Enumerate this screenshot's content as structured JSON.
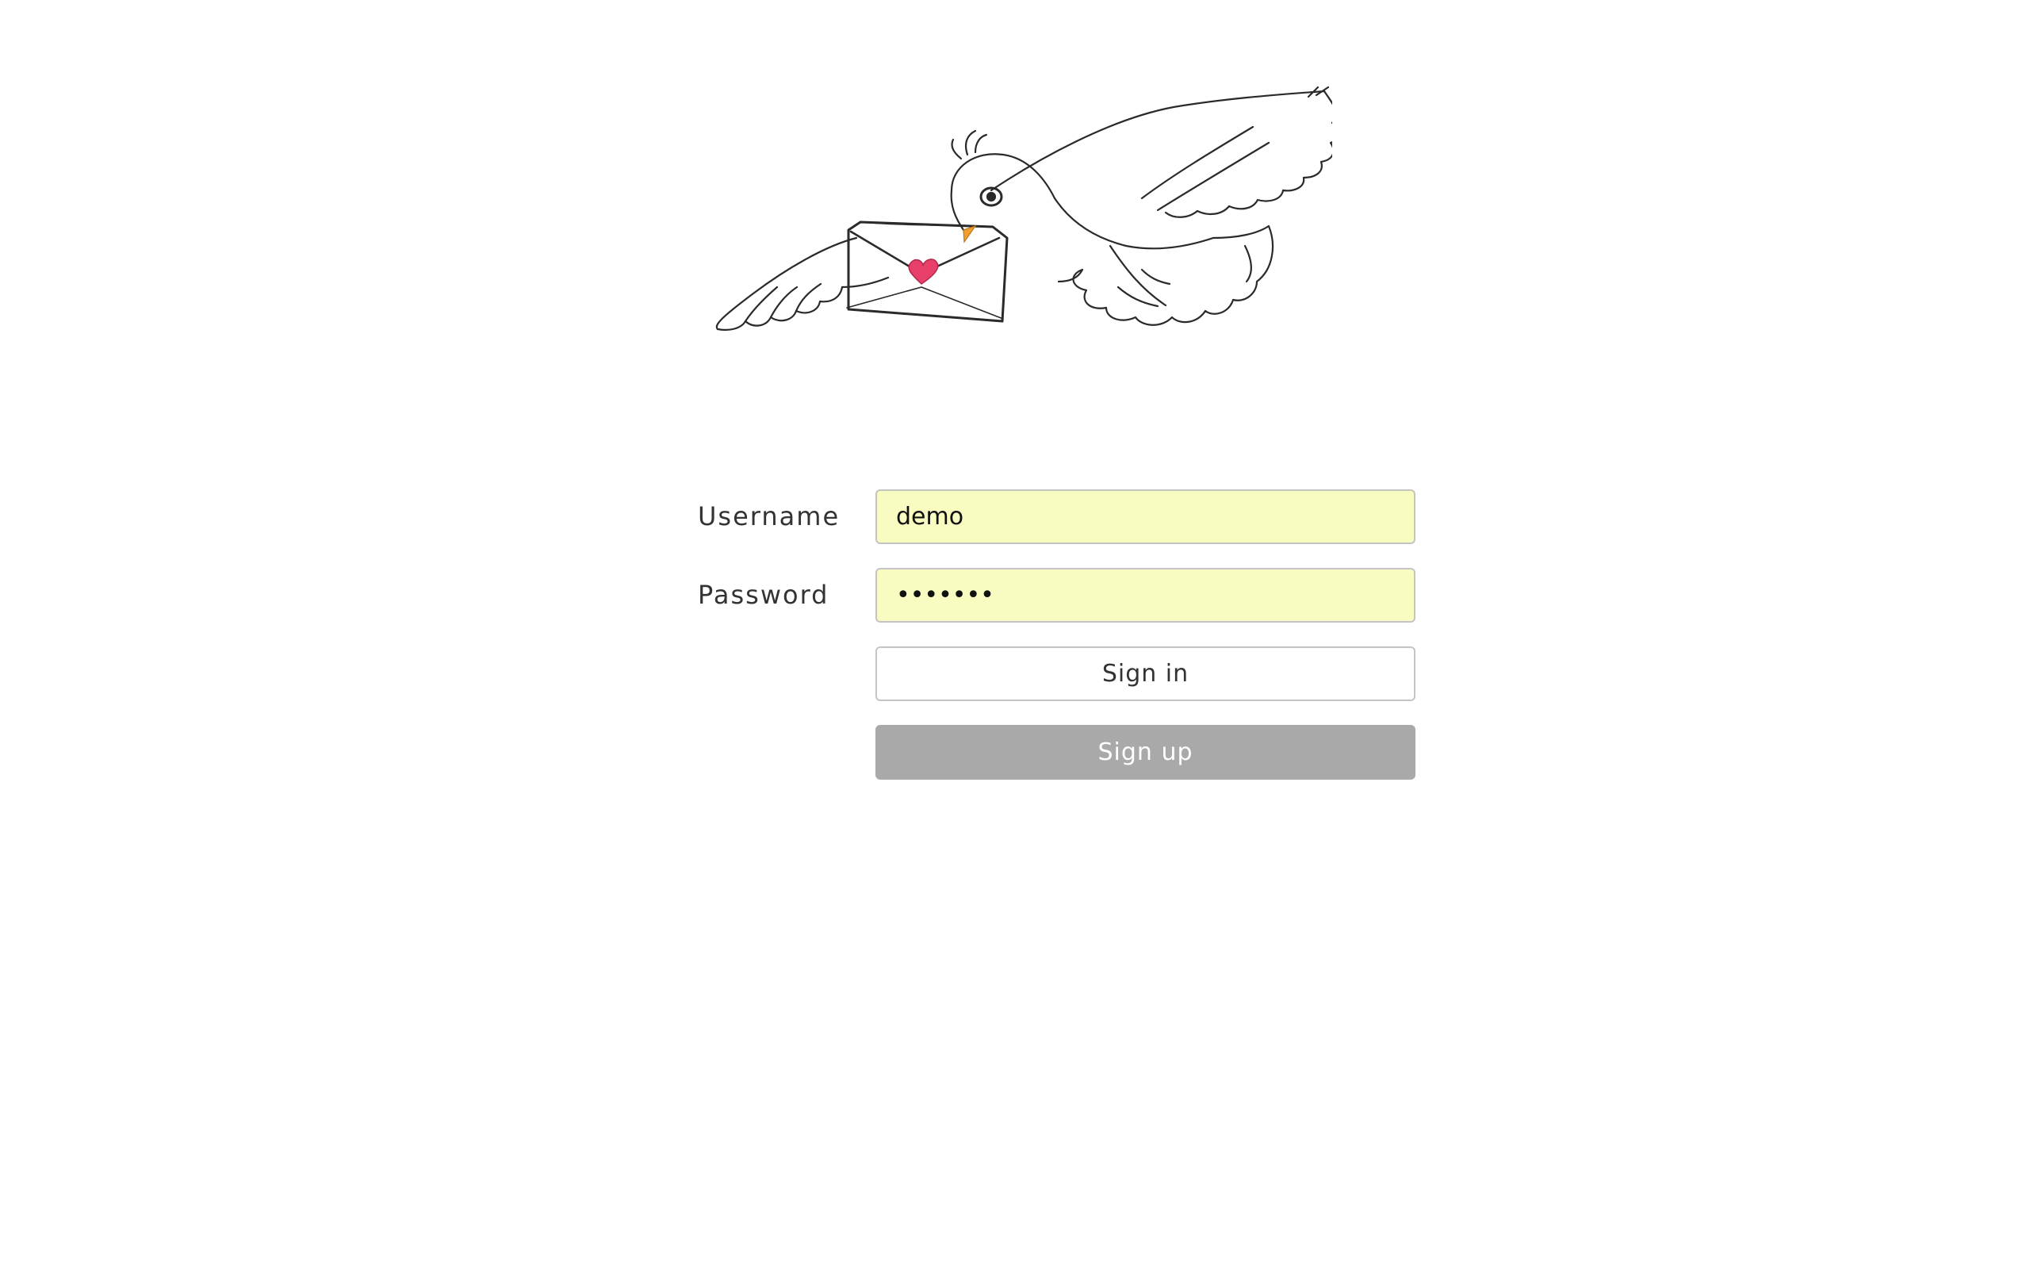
{
  "logo": {
    "icon": "dove-carrying-envelope-icon",
    "heart_color": "#e8406a",
    "beak_color": "#f0a030"
  },
  "form": {
    "username_label": "Username",
    "username_value": "demo",
    "password_label": "Password",
    "password_value": "demo123",
    "signin_label": "Sign in",
    "signup_label": "Sign up"
  },
  "colors": {
    "field_background": "#f9fcc0",
    "signup_background": "#a9a9a9",
    "border": "#c4c4c4"
  }
}
